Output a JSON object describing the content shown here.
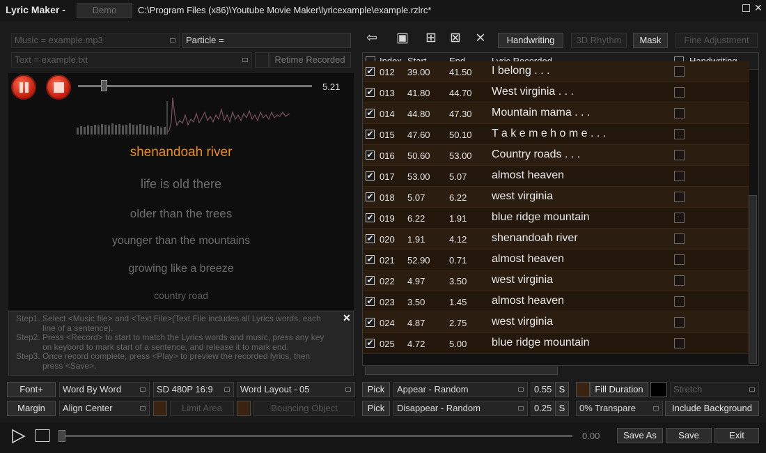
{
  "window": {
    "app_title": "Lyric Maker -",
    "demo_label": "Demo",
    "file_path": "C:\\Program Files (x86)\\Youtube Movie Maker\\lyricexample\\example.rzlrc*"
  },
  "left": {
    "music_field": "Music = example.mp3",
    "text_field": "Text = example.txt",
    "particle_field": "Particle =",
    "retime_label": "Retime Recorded",
    "player_time": "5.21",
    "lyrics": {
      "current": "shenandoah river",
      "line2": "life is old there",
      "line3": "older than the trees",
      "line4": "younger than the mountains",
      "line5": "growing like a breeze",
      "line6": "country road"
    },
    "steps": {
      "s1": "Step1. Select <Music file> and <Text File>(Text File includes all Lyrics words, each",
      "s1b": "line of a sentence).",
      "s2": "Step2. Press <Record> to start to match the Lyrics words and music, press any key",
      "s2b": "on keybord to mark start of a sentence, and release it to mark end.",
      "s3": "Step3. Once record complete, press <Play> to preview the recorded lyrics, then",
      "s3b": "press <Save>."
    }
  },
  "toolbar": {
    "handwriting": "Handwriting",
    "rhythm": "3D Rhythm",
    "mask": "Mask",
    "fine_adjustment": "Fine Adjustment"
  },
  "grid": {
    "headers": {
      "index": "Index",
      "start": "Start",
      "end": "End",
      "lyric": "Lyric Recorded",
      "handwriting": "Handwriting"
    },
    "rows": [
      {
        "index": "012",
        "start": "39.00",
        "end": "41.50",
        "lyric": "I belong . . .",
        "checked": "✔"
      },
      {
        "index": "013",
        "start": "41.80",
        "end": "44.70",
        "lyric": "West virginia . . .",
        "checked": "✔"
      },
      {
        "index": "014",
        "start": "44.80",
        "end": "47.30",
        "lyric": "Mountain mama . . .",
        "checked": "✔"
      },
      {
        "index": "015",
        "start": "47.60",
        "end": "50.10",
        "lyric": "T a k e m e h o m e . . .",
        "checked": "✔"
      },
      {
        "index": "016",
        "start": "50.60",
        "end": "53.00",
        "lyric": "Country roads . . .",
        "checked": "✔"
      },
      {
        "index": "017",
        "start": "53.00",
        "end": "5.07",
        "lyric": "almost heaven",
        "checked": "✔"
      },
      {
        "index": "018",
        "start": "5.07",
        "end": "6.22",
        "lyric": "west virginia",
        "checked": "✔"
      },
      {
        "index": "019",
        "start": "6.22",
        "end": "1.91",
        "lyric": "blue ridge mountain",
        "checked": "✔"
      },
      {
        "index": "020",
        "start": "1.91",
        "end": "4.12",
        "lyric": "shenandoah river",
        "checked": "✔"
      },
      {
        "index": "021",
        "start": "52.90",
        "end": "0.71",
        "lyric": "almost heaven",
        "checked": "✔"
      },
      {
        "index": "022",
        "start": "4.97",
        "end": "3.50",
        "lyric": "west virginia",
        "checked": "✔"
      },
      {
        "index": "023",
        "start": "3.50",
        "end": "1.45",
        "lyric": "almost heaven",
        "checked": "✔"
      },
      {
        "index": "024",
        "start": "4.87",
        "end": "2.75",
        "lyric": "west virginia",
        "checked": "✔"
      },
      {
        "index": "025",
        "start": "4.72",
        "end": "5.00",
        "lyric": "blue ridge mountain",
        "checked": "✔"
      }
    ]
  },
  "controls": {
    "font": "Font+",
    "margin": "Margin",
    "word_by_word": "Word By Word",
    "align_center": "Align Center",
    "resolution": "SD 480P 16:9",
    "limit_area": "Limit Area",
    "word_layout": "Word Layout - 05",
    "bouncing_object": "Bouncing Object",
    "pick1": "Pick",
    "pick2": "Pick",
    "appear": "Appear - Random",
    "disappear": "Disappear - Random",
    "appear_time": "0.55",
    "disappear_time": "0.25",
    "s1": "S",
    "s2": "S",
    "fill_duration": "Fill Duration",
    "stretch": "Stretch",
    "transparent": "0% Transpare",
    "include_background": "Include Background"
  },
  "bottom": {
    "time": "0.00",
    "save_as": "Save As",
    "save": "Save",
    "exit": "Exit"
  },
  "colors": {
    "accent": "#e8901e",
    "row": "#2b1d10",
    "background": "#1b1b1b"
  }
}
